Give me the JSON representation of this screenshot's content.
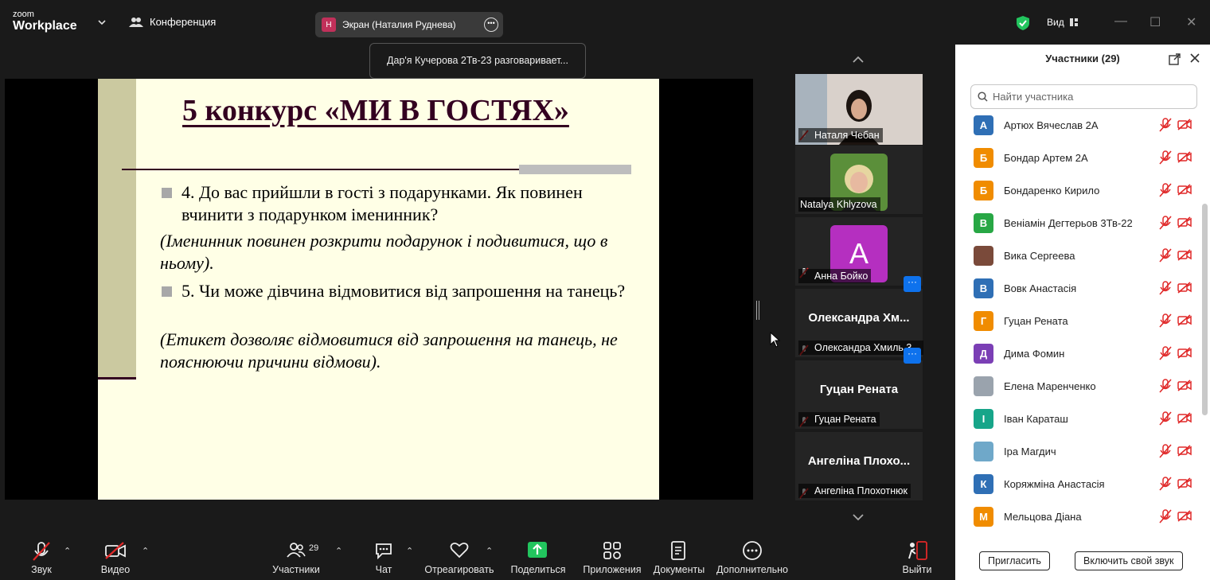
{
  "app": {
    "brand_line1": "zoom",
    "brand_line2": "Workplace",
    "conference_label": "Конференция",
    "screen_share_avatar": "Н",
    "screen_share_label": "Экран (Наталия Руднева)",
    "view_label": "Вид"
  },
  "colors": {
    "accent_blue": "#0e72ed",
    "mute_red": "#e02828",
    "share_green": "#22c55e",
    "slide_bg": "#ffffe6",
    "slide_title": "#330020"
  },
  "toast": "Дар'я Кучерова 2Тв-23 разговаривает...",
  "slide": {
    "title": "5 конкурс «МИ В ГОСТЯХ»",
    "q1": "4. До вас прийшли в гості з подарунками. Як повинен вчинити з подарунком іменинник?",
    "a1": "(Іменинник повинен розкрити подарунок і подивитися, що в ньому).",
    "q2": "5. Чи може дівчина відмовитися від запрошення на танець?",
    "a2": "(Етикет дозволяє відмовитися від запрошення на танець, не пояснюючи причини відмови)."
  },
  "thumbnails": [
    {
      "name": "Наталя Чебан",
      "big": ""
    },
    {
      "name": "Natalya Khlyzova",
      "big": ""
    },
    {
      "name": "Анна Бойко",
      "big": "",
      "avatar": "A"
    },
    {
      "name": "Олександра Хмиль 3...",
      "big": "Олександра  Хм..."
    },
    {
      "name": "Гуцан Рената",
      "big": "Гуцан Рената"
    },
    {
      "name": "Ангеліна Плохотнюк",
      "big": "Ангеліна  Плохо..."
    }
  ],
  "toolbar": {
    "audio": "Звук",
    "video": "Видео",
    "participants": "Участники",
    "participants_count": "29",
    "chat": "Чат",
    "react": "Отреагировать",
    "share": "Поделиться",
    "apps": "Приложения",
    "docs": "Документы",
    "more": "Дополнительно",
    "leave": "Выйти"
  },
  "panel": {
    "title": "Участники (29)",
    "search_placeholder": "Найти участника",
    "invite": "Пригласить",
    "unmute": "Включить свой звук",
    "participants": [
      {
        "initial": "А",
        "name": "Артюх Вячеслав 2А",
        "color": "#2f6fb5"
      },
      {
        "initial": "Б",
        "name": "Бондар Артем 2А",
        "color": "#f08c00"
      },
      {
        "initial": "Б",
        "name": "Бондаренко Кирило",
        "color": "#f08c00"
      },
      {
        "initial": "В",
        "name": "Веніамін Дегтерьов 3Тв-22",
        "color": "#28a745"
      },
      {
        "initial": "",
        "name": "Вика Сергеева",
        "color": "#7a4a3a"
      },
      {
        "initial": "В",
        "name": "Вовк Анастасія",
        "color": "#2f6fb5"
      },
      {
        "initial": "Г",
        "name": "Гуцан Рената",
        "color": "#f08c00"
      },
      {
        "initial": "Д",
        "name": "Дима Фомин",
        "color": "#7b3fb5"
      },
      {
        "initial": "",
        "name": "Елена Маренченко",
        "color": "#9aa3ad"
      },
      {
        "initial": "І",
        "name": "Іван Караташ",
        "color": "#17a589"
      },
      {
        "initial": "",
        "name": "Іра Магдич",
        "color": "#6fa8c9"
      },
      {
        "initial": "К",
        "name": "Коряжміна Анастасія",
        "color": "#2f6fb5"
      },
      {
        "initial": "М",
        "name": "Мельцова Діана",
        "color": "#f08c00"
      }
    ]
  }
}
